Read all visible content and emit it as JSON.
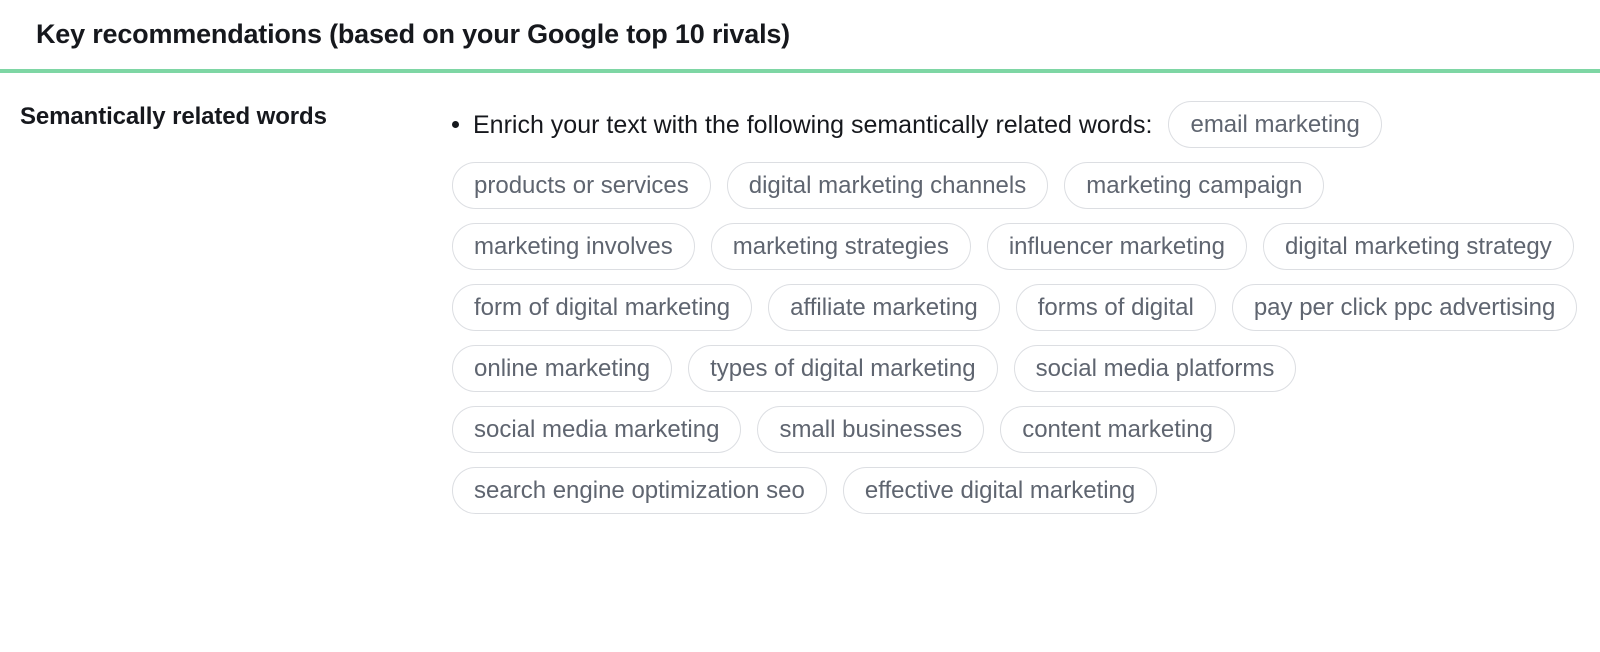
{
  "header": {
    "title": "Key recommendations (based on your Google top 10 rivals)",
    "accent_color": "#7ed6a4"
  },
  "section": {
    "label": "Semantically related words",
    "lead_text": "Enrich your text with the following semantically related words:",
    "bullet_marker": "•",
    "tag_text_color": "#5f6570",
    "tag_border_color": "#dcdee2",
    "tags": [
      "email marketing",
      "products or services",
      "digital marketing channels",
      "marketing campaign",
      "marketing involves",
      "marketing strategies",
      "influencer marketing",
      "digital marketing strategy",
      "form of digital marketing",
      "affiliate marketing",
      "forms of digital",
      "pay per click ppc advertising",
      "online marketing",
      "types of digital marketing",
      "social media platforms",
      "social media marketing",
      "small businesses",
      "content marketing",
      "search engine optimization seo",
      "effective digital marketing"
    ]
  }
}
